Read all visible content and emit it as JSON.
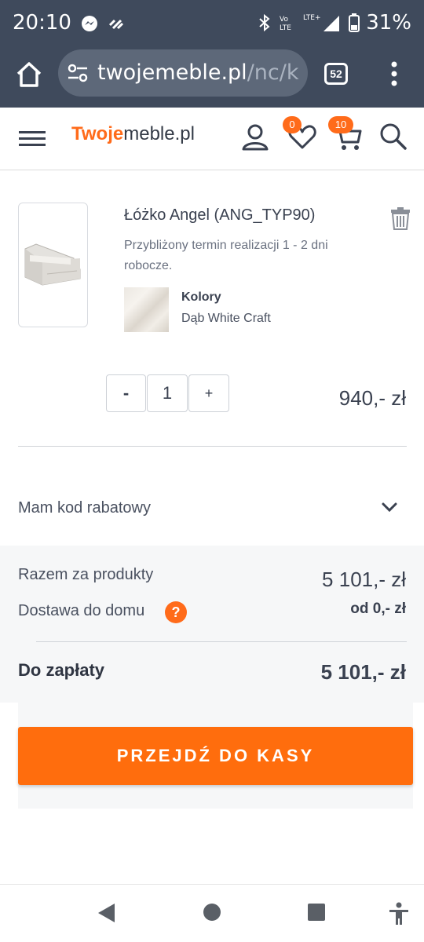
{
  "status_bar": {
    "time": "20:10",
    "battery": "31%",
    "icons": [
      "messenger-icon",
      "cast-icon",
      "bluetooth-icon",
      "volte-icon",
      "lte-plus-icon",
      "signal-icon",
      "battery-icon"
    ]
  },
  "browser": {
    "url_domain": "twojemeble.pl",
    "url_path": "/nc/k",
    "tab_count": "52"
  },
  "site": {
    "logo_accent": "Twoje",
    "logo_rest": "meble.pl",
    "wishlist_count": "0",
    "cart_count": "10"
  },
  "cart_item": {
    "name": "Łóżko Angel (ANG_TYP90)",
    "lead_time": "Przybliżony termin realizacji 1 - 2 dni robocze.",
    "color_label": "Kolory",
    "color_value": "Dąb White Craft",
    "qty_minus": "-",
    "quantity": "1",
    "qty_plus": "+",
    "price": "940,- zł"
  },
  "coupon": {
    "label": "Mam kod rabatowy"
  },
  "summary": {
    "products_label": "Razem za produkty",
    "products_value": "5 101,- zł",
    "delivery_label": "Dostawa do domu",
    "delivery_help": "?",
    "delivery_value": "od 0,- zł",
    "total_label": "Do zapłaty",
    "total_value": "5 101,- zł"
  },
  "checkout": {
    "button_label": "PRZEJDŹ DO KASY"
  },
  "colors": {
    "accent": "#ff6d0d",
    "chrome": "#3f4a5c",
    "text": "#3a4150"
  }
}
